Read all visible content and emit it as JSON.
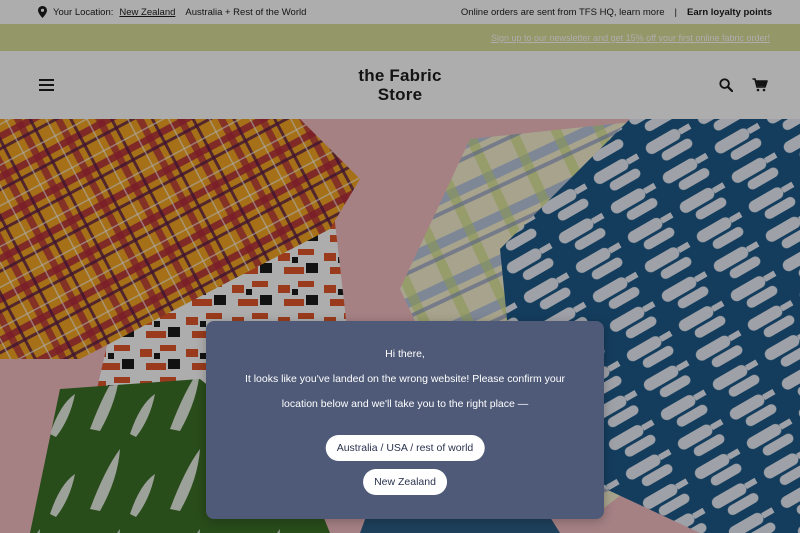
{
  "topbar": {
    "location_label": "Your Location:",
    "location_value": "New Zealand",
    "alt_region": "Australia + Rest of the World",
    "orders_note": "Online orders are sent from TFS HQ, learn more",
    "separator": "|",
    "loyalty": "Earn loyalty points"
  },
  "promo": {
    "text": "Sign up to our newsletter and get 15% off your first online fabric order!"
  },
  "header": {
    "logo_line1": "the Fabric",
    "logo_line2": "Store",
    "icons": {
      "menu": "hamburger-menu-icon",
      "search": "search-icon",
      "cart": "cart-icon"
    }
  },
  "modal": {
    "greeting": "Hi there,",
    "message": "It looks like you've landed on the wrong website! Please confirm your location below and we'll take you to the right place —",
    "buttons": {
      "au": "Australia / USA / rest of world",
      "nz": "New Zealand"
    }
  },
  "colors": {
    "promo_bg": "#dbdf9a",
    "modal_bg": "#4f5a78",
    "hero_bg": "#f4bfc3",
    "overlay": "rgba(0,0,0,0.32)"
  }
}
